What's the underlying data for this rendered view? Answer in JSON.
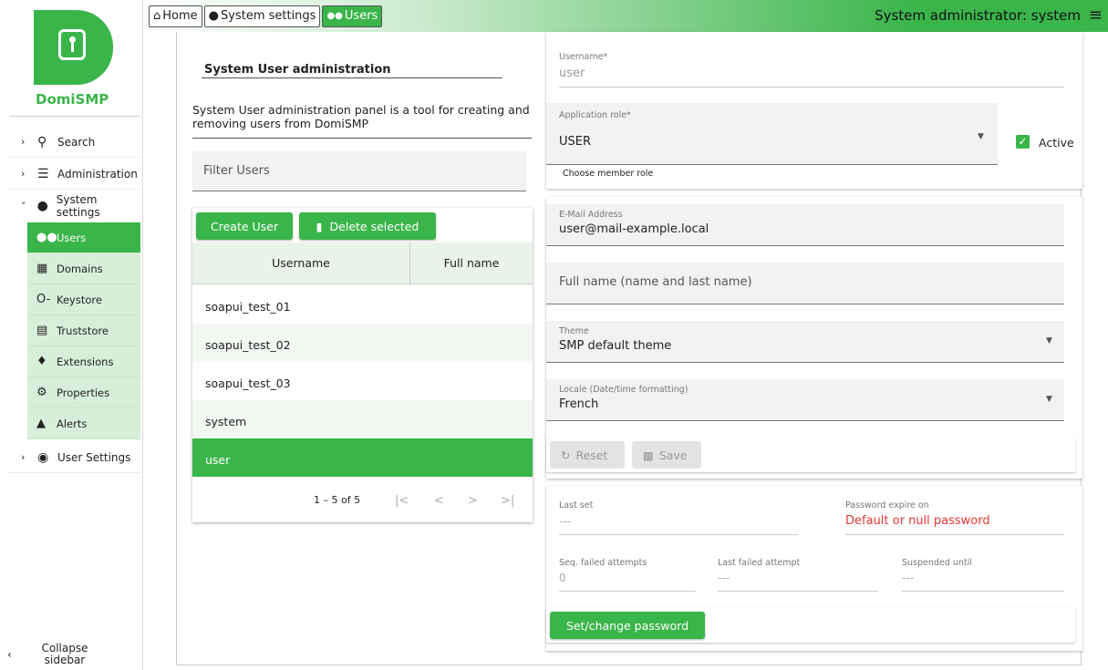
{
  "app": {
    "logo_text": "DomiSMP"
  },
  "sidebar": {
    "items": [
      {
        "label": "Search",
        "icon": "search-icon"
      },
      {
        "label": "Administration",
        "icon": "sliders-icon"
      },
      {
        "label": "System settings",
        "icon": "system-settings-icon"
      },
      {
        "label": "User Settings",
        "icon": "account-circle-icon"
      }
    ],
    "subitems": [
      {
        "label": "Users",
        "icon": "users-icon"
      },
      {
        "label": "Domains",
        "icon": "domains-icon"
      },
      {
        "label": "Keystore",
        "icon": "key-icon"
      },
      {
        "label": "Truststore",
        "icon": "truststore-icon"
      },
      {
        "label": "Extensions",
        "icon": "puzzle-icon"
      },
      {
        "label": "Properties",
        "icon": "gear-icon"
      },
      {
        "label": "Alerts",
        "icon": "bell-icon"
      }
    ],
    "collapse_label": "Collapse sidebar"
  },
  "breadcrumb": [
    "Home",
    "System settings",
    "Users"
  ],
  "header": {
    "admin_label": "System administrator: system"
  },
  "panel": {
    "title": "System User administration",
    "description": "System User administration panel is a tool for creating and removing users from DomiSMP",
    "filter_placeholder": "Filter Users",
    "create_button": "Create User",
    "delete_button": "Delete selected",
    "columns": [
      "Username",
      "Full name"
    ],
    "rows": [
      "soapui_test_01",
      "soapui_test_02",
      "soapui_test_03",
      "system",
      "user"
    ],
    "selected_row": "user",
    "paging": "1 – 5 of 5"
  },
  "form": {
    "username_label": "Username*",
    "username_value": "user",
    "role_label": "Application role*",
    "role_value": "USER",
    "role_hint": "Choose member role",
    "active_label": "Active",
    "email_label": "E-Mail Address",
    "email_value": "user@mail-example.local",
    "fullname_placeholder": "Full name (name and last name)",
    "theme_label": "Theme",
    "theme_value": "SMP default theme",
    "locale_label": "Locale (Date/time formatting)",
    "locale_value": "French",
    "reset_button": "Reset",
    "save_button": "Save"
  },
  "password": {
    "last_set_label": "Last set",
    "last_set_value": "---",
    "expire_label": "Password expire on",
    "expire_value": "Default or null password",
    "failed_label": "Seq. failed attempts",
    "failed_value": "0",
    "last_failed_label": "Last failed attempt",
    "last_failed_value": "---",
    "suspended_label": "Suspended until",
    "suspended_value": "---",
    "set_button": "Set/change password"
  },
  "colors": {
    "accent": "#3ab54a",
    "error": "#e53935"
  }
}
